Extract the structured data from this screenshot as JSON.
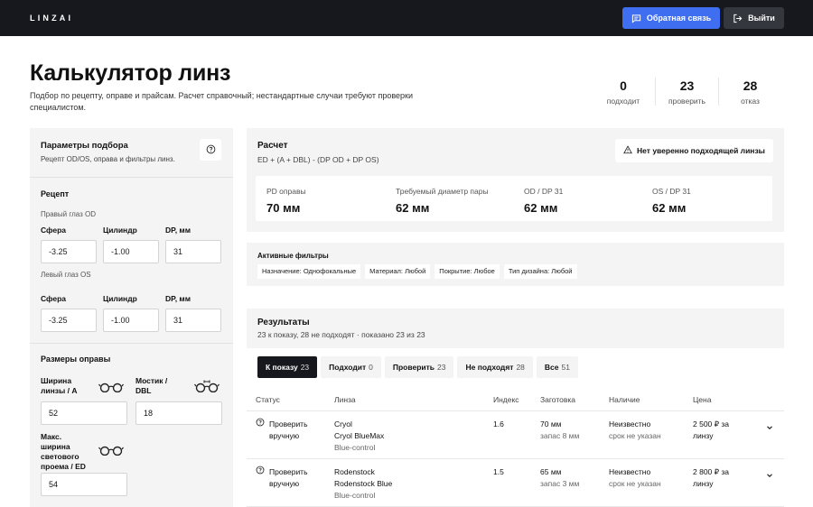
{
  "header": {
    "logo": "LINZAI",
    "feedback_label": "Обратная связь",
    "logout_label": "Выйти"
  },
  "page": {
    "title": "Калькулятор линз",
    "subtitle": "Подбор по рецепту, оправе и прайсам. Расчет справочный; нестандартные случаи требуют проверки специалистом."
  },
  "stats": [
    {
      "value": "0",
      "label": "подходит"
    },
    {
      "value": "23",
      "label": "проверить"
    },
    {
      "value": "28",
      "label": "отказ"
    }
  ],
  "params": {
    "title": "Параметры подбора",
    "subtitle": "Рецепт OD/OS, оправа и фильтры линз.",
    "recipe_title": "Рецепт",
    "right_eye": "Правый глаз OD",
    "left_eye": "Левый глаз OS",
    "sphere_label": "Сфера",
    "cylinder_label": "Цилиндр",
    "dp_label": "DP, мм",
    "od": {
      "sphere": "-3.25",
      "cylinder": "-1.00",
      "dp": "31"
    },
    "os": {
      "sphere": "-3.25",
      "cylinder": "-1.00",
      "dp": "31"
    },
    "frame_title": "Размеры оправы",
    "lens_width_label": "Ширина линзы / A",
    "bridge_label": "Мостик / DBL",
    "max_width_label": "Макс. ширина светового проема / ED",
    "lens_width": "52",
    "bridge": "18",
    "max_width": "54"
  },
  "calc": {
    "title": "Расчет",
    "formula": "ED + (A + DBL) - (DP OD + DP OS)",
    "warning": "Нет уверенно подходящей линзы",
    "items": [
      {
        "label": "PD оправы",
        "value": "70 мм"
      },
      {
        "label": "Требуемый диаметр пары",
        "value": "62 мм"
      },
      {
        "label": "OD / DP 31",
        "value": "62 мм"
      },
      {
        "label": "OS / DP 31",
        "value": "62 мм"
      }
    ]
  },
  "filters": {
    "title": "Активные фильтры",
    "chips": [
      "Назначение: Однофокальные",
      "Материал: Любой",
      "Покрытие: Любое",
      "Тип дизайна: Любой"
    ]
  },
  "results": {
    "title": "Результаты",
    "subtitle": "23 к показу, 28 не подходят · показано 23 из 23",
    "tabs": [
      {
        "label": "К показу",
        "count": "23"
      },
      {
        "label": "Подходит",
        "count": "0"
      },
      {
        "label": "Проверить",
        "count": "23"
      },
      {
        "label": "Не подходят",
        "count": "28"
      },
      {
        "label": "Все",
        "count": "51"
      }
    ],
    "columns": [
      "Статус",
      "Линза",
      "Индекс",
      "Заготовка",
      "Наличие",
      "Цена"
    ],
    "rows": [
      {
        "status1": "Проверить",
        "status2": "вручную",
        "brand": "Cryol",
        "name": "Cryol BlueMax",
        "coating": "Blue-control",
        "index": "1.6",
        "blank": "70 мм",
        "reserve": "запас 8 мм",
        "avail": "Неизвестно",
        "term": "срок не указан",
        "price": "2 500 ₽ за",
        "price_unit": "линзу"
      },
      {
        "status1": "Проверить",
        "status2": "вручную",
        "brand": "Rodenstock",
        "name": "Rodenstock Blue",
        "coating": "Blue-control",
        "index": "1.5",
        "blank": "65 мм",
        "reserve": "запас 3 мм",
        "avail": "Неизвестно",
        "term": "срок не указан",
        "price": "2 800 ₽ за",
        "price_unit": "линзу"
      }
    ]
  }
}
